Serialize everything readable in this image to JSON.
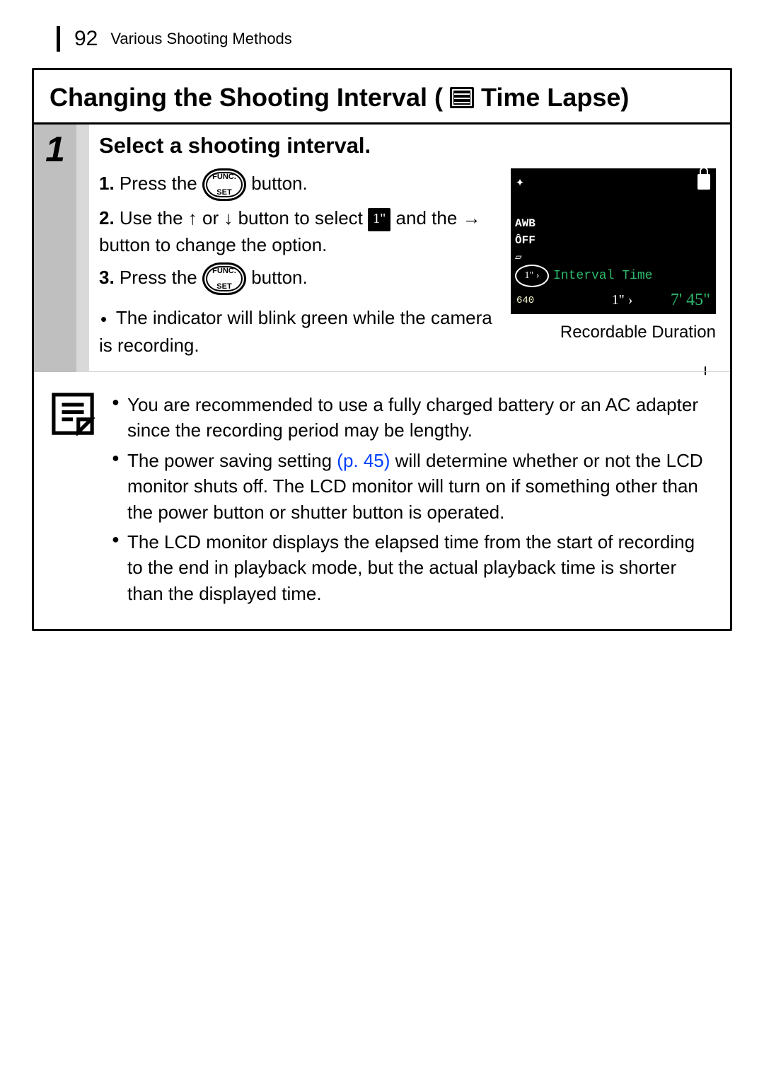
{
  "header": {
    "page_number": "92",
    "chapter_title": "Various Shooting Methods"
  },
  "main_title_pre": "Changing the Shooting Interval (",
  "main_title_post": " Time Lapse)",
  "step": {
    "number": "1",
    "title": "Select a shooting interval.",
    "items": {
      "i1_num": "1.",
      "i1_a": "Press the ",
      "i1_b": " button.",
      "i2_num": "2.",
      "i2_a": "Use the ",
      "i2_b": " or ",
      "i2_c": " button to select ",
      "i2_badge": "1\"",
      "i2_d": " and the ",
      "i2_e": " button to change the option.",
      "i3_num": "3.",
      "i3_a": "Press the ",
      "i3_b": " button."
    },
    "indicator_note": "The indicator will blink green while the camera is recording."
  },
  "func_label_top": "FUNC.",
  "func_label_bot": "SET",
  "arrows": {
    "up": "↑",
    "down": "↓",
    "right": "→"
  },
  "lcd": {
    "awb": "AWB",
    "off": "ÔFF",
    "interval_label": "Interval Time",
    "oval_value": "1\" ›",
    "current_value": "1\" ›",
    "resolution": "640",
    "duration": "7' 45\""
  },
  "recordable_duration_label": "Recordable Duration",
  "notes": {
    "n1": "You are recommended to use a fully charged battery or an AC adapter since the recording period may be lengthy.",
    "n2_a": "The power saving setting ",
    "n2_ref": "(p. 45)",
    "n2_b": " will determine whether or not the LCD monitor shuts off. The LCD monitor will turn on if something other than the power button or shutter button is operated.",
    "n3": "The LCD monitor displays the elapsed time from the start of recording to the end in playback mode, but the actual playback time is shorter than the displayed time."
  }
}
